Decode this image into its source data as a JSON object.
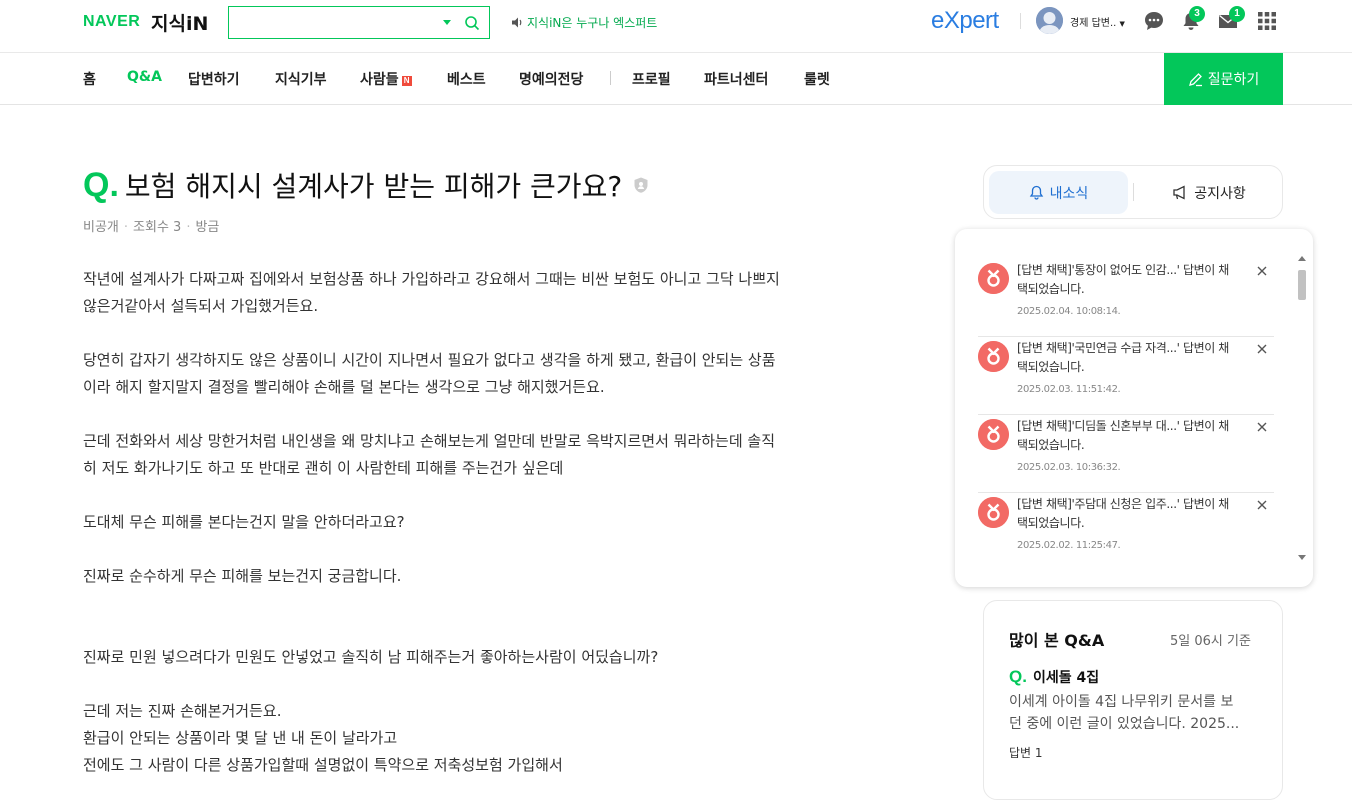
{
  "header": {
    "naver_logo": "NAVER",
    "kin_logo": "지식iN",
    "search": {
      "value": "",
      "placeholder": ""
    },
    "promo_text": "지식iN은 누구나 엑스퍼트",
    "expert_logo": "eXpert",
    "user_name": "경제 답변..",
    "notification_count": "3",
    "mail_count": "1"
  },
  "nav": {
    "items": [
      "홈",
      "Q&A",
      "답변하기",
      "지식기부",
      "사람들",
      "베스트",
      "명예의전당",
      "프로필",
      "파트너센터",
      "룰렛"
    ],
    "active": "Q&A",
    "new_badge": "N",
    "ask_button": "질문하기"
  },
  "question": {
    "q_mark": "Q.",
    "title": "보험 해지시 설계사가 받는 피해가 큰가요?",
    "meta": {
      "visibility": "비공개",
      "views": "조회수 3",
      "time": "방금"
    },
    "paragraphs": [
      [
        "작년에 설계사가 다짜고짜 집에와서 보험상품 하나 가입하라고 강요해서 그때는 비싼 보험도 아니고 그닥 나쁘지",
        "않은거같아서 설득되서 가입했거든요."
      ],
      [
        "당연히 갑자기 생각하지도 않은 상품이니 시간이 지나면서 필요가 없다고 생각을 하게 됐고, 환급이 안되는 상품",
        "이라 해지 할지말지 결정을 빨리해야 손해를 덜 본다는 생각으로 그냥 해지했거든요."
      ],
      [
        "근데 전화와서 세상 망한거처럼 내인생을 왜 망치냐고 손해보는게 얼만데 반말로 윽박지르면서 뭐라하는데 솔직",
        "히 저도 화가나기도 하고 또 반대로 괜히 이 사람한테 피해를 주는건가 싶은데"
      ],
      [
        "도대체 무슨 피해를 본다는건지 말을 안하더라고요?"
      ],
      [
        "진짜로 순수하게 무슨 피해를 보는건지 궁금합니다."
      ],
      [
        ""
      ],
      [
        "진짜로 민원 넣으려다가 민원도 안넣었고 솔직히 남 피해주는거 좋아하는사람이 어딨습니까?"
      ],
      [
        "근데 저는 진짜 손해본거거든요.",
        "환급이 안되는 상품이라 몇 달 낸 내 돈이 날라가고",
        "전에도 그 사람이 다른 상품가입할때 설명없이 특약으로 저축성보험 가입해서"
      ]
    ]
  },
  "sidebar": {
    "tab_active": "내소식",
    "tab_other": "공지사항",
    "notifications": [
      {
        "text": "[답변 채택]'통장이 없어도 인감...' 답변이 채택되었습니다.",
        "time": "2025.02.04. 10:08:14."
      },
      {
        "text": "[답변 채택]'국민연금 수급 자격...' 답변이 채택되었습니다.",
        "time": "2025.02.03. 11:51:42."
      },
      {
        "text": "[답변 채택]'디딤돌 신혼부부 대...' 답변이 채택되었습니다.",
        "time": "2025.02.03. 10:36:32."
      },
      {
        "text": "[답변 채택]'주담대 신청은 입주...' 답변이 채택되었습니다.",
        "time": "2025.02.02. 11:25:47."
      }
    ],
    "popular": {
      "title": "많이 본 Q&A",
      "time": "5일 06시 기준",
      "q_mark": "Q.",
      "question": "이세돌 4집",
      "desc_line1": "이세계 아이돌 4집 나무위키 문서를 보",
      "desc_line2": "던 중에 이런 글이 있었습니다. 2025...",
      "answers": "답변 1"
    }
  },
  "colors": {
    "brand": "#03c75a",
    "expert": "#2a7de1",
    "notif_icon": "#f26a65",
    "tab_active": "#1f6fd1"
  }
}
